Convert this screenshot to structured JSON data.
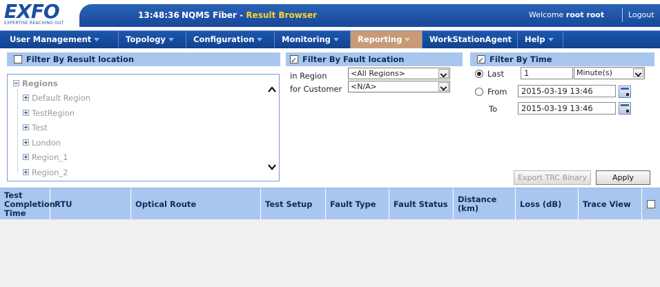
{
  "logo": {
    "brand": "EXFO",
    "tagline": "EXPERTISE REACHING OUT"
  },
  "topbar": {
    "clock": "13:48:36",
    "product_name": "NQMS Fiber - ",
    "product_section": "Result Browser",
    "welcome_prefix": "Welcome ",
    "welcome_user": "root root",
    "logout": "Logout"
  },
  "menu": {
    "items": [
      {
        "label": "User Management",
        "active": false
      },
      {
        "label": "Topology",
        "active": false
      },
      {
        "label": "Configuration",
        "active": false
      },
      {
        "label": "Monitoring",
        "active": false
      },
      {
        "label": "Reporting",
        "active": true
      },
      {
        "label": "WorkStationAgent",
        "active": false
      },
      {
        "label": "Help",
        "active": false
      }
    ]
  },
  "filter_location": {
    "title": "Filter By Result location",
    "checked": false,
    "tree": {
      "root": "Regions",
      "children": [
        "Default Region",
        "TestRegion",
        "Test",
        "London",
        "Region_1",
        "Region_2"
      ]
    }
  },
  "filter_fault": {
    "title": "Filter By Fault location",
    "checked": true,
    "region_label": "in Region",
    "region_value": "<All Regions>",
    "customer_label": "for Customer",
    "customer_value": "<N/A>"
  },
  "filter_time": {
    "title": "Filter By Time",
    "checked": true,
    "last_label": "Last",
    "last_selected": true,
    "last_value": "1",
    "unit_value": "Minute(s)",
    "from_label": "From",
    "from_value": "2015-03-19 13:46",
    "to_label": "To",
    "to_value": "2015-03-19 13:46"
  },
  "buttons": {
    "export": "Export TRC Binary",
    "apply": "Apply"
  },
  "table": {
    "columns": [
      "Test Completion Time",
      "RTU",
      "Optical Route",
      "Test Setup",
      "Fault Type",
      "Fault Status",
      "Distance (km)",
      "Loss (dB)",
      "Trace View"
    ],
    "rows": []
  }
}
